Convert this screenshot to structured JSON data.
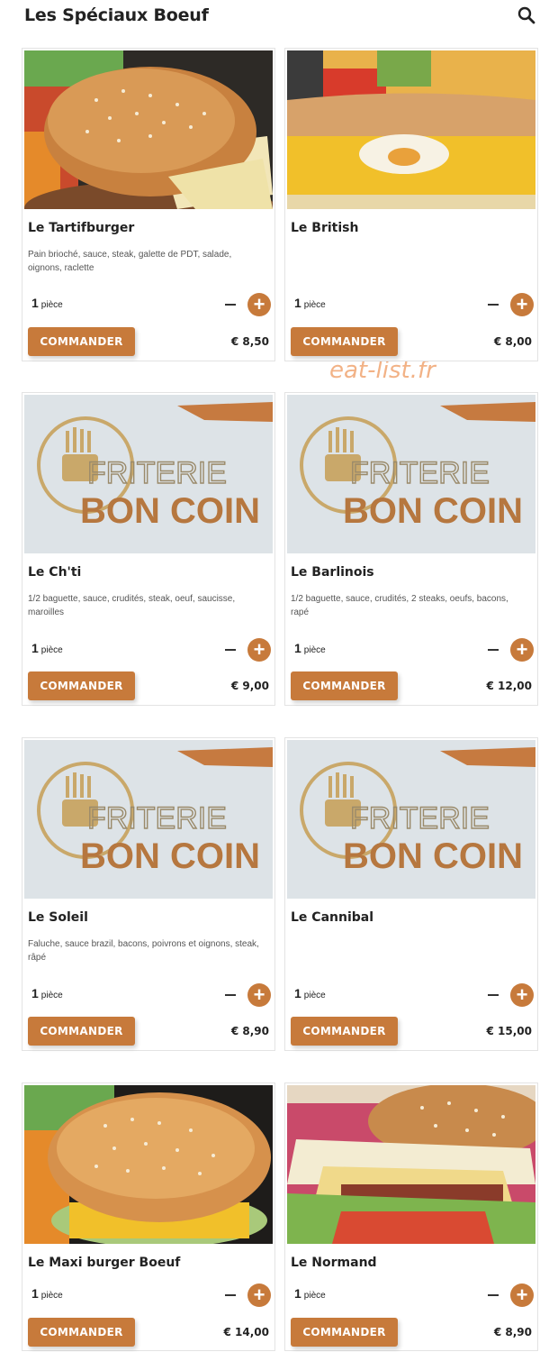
{
  "header": {
    "title": "Les Spéciaux Boeuf",
    "search_icon": "search-icon"
  },
  "watermark": "eat-list.fr",
  "colors": {
    "accent": "#c77a3b",
    "text": "#222222",
    "border": "#e3e3e3"
  },
  "products": [
    {
      "name": "Le Tartifburger",
      "description": "Pain brioché, sauce, steak, galette de PDT, salade, oignons, raclette",
      "qty": "1",
      "unit": "pièce",
      "button": "COMMANDER",
      "price": "€ 8,50",
      "image": "burger-photo"
    },
    {
      "name": "Le British",
      "description": "",
      "qty": "1",
      "unit": "pièce",
      "button": "COMMANDER",
      "price": "€ 8,00",
      "image": "sandwich-egg-cheese-photo"
    },
    {
      "name": "Le Ch'ti",
      "description": "1/2 baguette, sauce, crudités, steak, oeuf, saucisse, maroilles",
      "qty": "1",
      "unit": "pièce",
      "button": "COMMANDER",
      "price": "€ 9,00",
      "image": "friterie-logo"
    },
    {
      "name": "Le Barlinois",
      "description": "1/2 baguette, sauce, crudités, 2 steaks, oeufs, bacons, rapé",
      "qty": "1",
      "unit": "pièce",
      "button": "COMMANDER",
      "price": "€ 12,00",
      "image": "friterie-logo"
    },
    {
      "name": "Le Soleil",
      "description": "Faluche, sauce brazil, bacons, poivrons et oignons, steak, râpé",
      "qty": "1",
      "unit": "pièce",
      "button": "COMMANDER",
      "price": "€ 8,90",
      "image": "friterie-logo"
    },
    {
      "name": "Le Cannibal",
      "description": "",
      "qty": "1",
      "unit": "pièce",
      "button": "COMMANDER",
      "price": "€ 15,00",
      "image": "friterie-logo"
    },
    {
      "name": "Le Maxi burger Boeuf",
      "description": "",
      "qty": "1",
      "unit": "pièce",
      "button": "COMMANDER",
      "price": "€ 14,00",
      "image": "burger-photo"
    },
    {
      "name": "Le Normand",
      "description": "",
      "qty": "1",
      "unit": "pièce",
      "button": "COMMANDER",
      "price": "€ 8,90",
      "image": "burger-camembert-photo"
    }
  ],
  "logo_text": {
    "line1": "FRITERIE",
    "line2": "BON COIN"
  }
}
